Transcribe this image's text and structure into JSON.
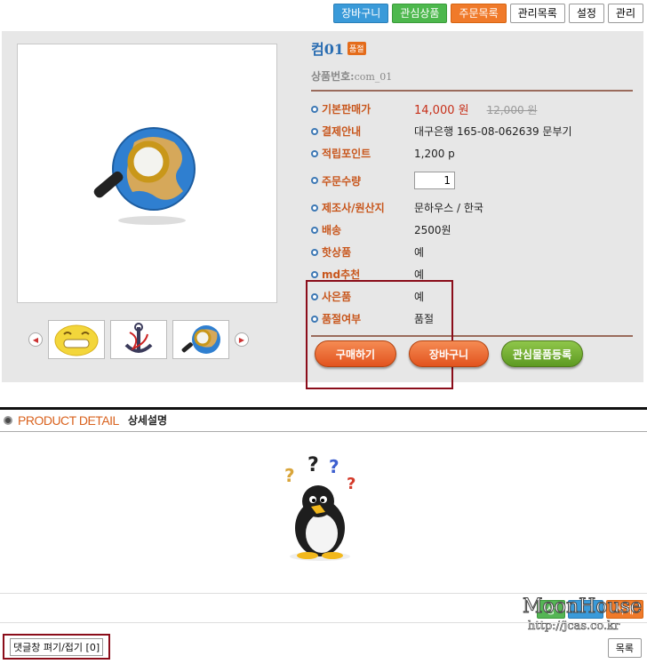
{
  "topbar": {
    "cart": "장바구니",
    "wishlist": "관심상품",
    "orders": "주문목록",
    "admin_list": "관리목록",
    "settings": "설정",
    "admin": "관리"
  },
  "product": {
    "name": "컴01",
    "sold_out_badge": "품절",
    "code_label": "상품번호:",
    "code_value": "com_01",
    "fields": {
      "price_label": "기본판매가",
      "price": "14,000 원",
      "orig_price": "12,000 원",
      "payment_label": "결제안내",
      "payment": "대구은행 165-08-062639 문부기",
      "points_label": "적립포인트",
      "points": "1,200 p",
      "qty_label": "주문수량",
      "qty": "1",
      "maker_label": "제조사/원산지",
      "maker": "문하우스 / 한국",
      "shipping_label": "배송",
      "shipping": "2500원",
      "hot_label": "핫상품",
      "hot": "예",
      "md_label": "md추천",
      "md": "예",
      "gift_label": "사은품",
      "gift": "예",
      "soldout_label": "품절여부",
      "soldout": "품절"
    },
    "actions": {
      "buy": "구매하기",
      "cart": "장바구니",
      "wish": "관심물품등록"
    }
  },
  "detail": {
    "heading": "PRODUCT DETAIL",
    "heading_ko": "상세설명"
  },
  "bottom": {
    "btn_green": "상",
    "btn_orange": "삭제",
    "comment_toggle": "댓글창 펴기/접기 [0]",
    "list": "목록"
  },
  "watermark": {
    "line1": "MoonHouse",
    "line2": "http://jcas.co.kr"
  }
}
